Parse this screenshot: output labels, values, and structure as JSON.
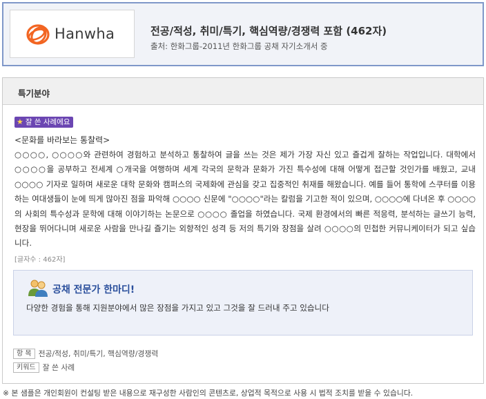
{
  "header": {
    "logo_text": "Hanwha",
    "title": "전공/적성, 취미/특기, 핵심역량/경쟁력 포함 (462자)",
    "source": "출처: 한화그룹-2011년 한화그룹 공채 자기소개서 중"
  },
  "panel": {
    "heading": "특기분야",
    "badge": "잘 쓴 사례에요",
    "essay_title": "<문화를 바라보는 통찰력>",
    "essay_body": "○○○○, ○○○○와 관련하여 경험하고 분석하고 통찰하여 글을 쓰는 것은 제가 가장 자신 있고 즐겁게 잘하는 작업입니다. 대학에서 ○○○○을 공부하고 전세계 ○개국을 여행하며 세계 각국의 문학과 문화가 가진 특수성에 대해 어떻게 접근할 것인가를 배웠고, 교내 ○○○○ 기자로 일하며 새로운 대학 문화와 캠퍼스의 국제화에 관심을 갖고 집중적인 취재를 해왔습니다. 예를 들어 통학에 스쿠터를 이용하는 여대생들이 눈에 띄게 많아진 점을 파악해 ○○○○ 신문에 \"○○○○\"라는 칼럼을 기고한 적이 있으며, ○○○○에 다녀온 후 ○○○○의 사회의 특수성과 문학에 대해 이야기하는 논문으로 ○○○○ 졸업을 하였습니다. 국제 환경에서의 빠른 적응력, 분석하는 글쓰기 능력, 현장을 뛰어다니며 새로운 사람을 만나길 즐기는 외향적인 성격 등 저의 특기와 장점을 살려 ○○○○의 민첩한 커뮤니케이터가 되고 싶습니다.",
    "char_count": "[글자수 : 462자]"
  },
  "expert": {
    "title": "공채 전문가 한마디!",
    "comment": "다양한 경험을 통해 지원분야에서 많은 장점을 가지고 있고 그것을 잘 드러내 주고 있습니다"
  },
  "tags": {
    "item_label": "항 목",
    "item_value": "전공/적성, 취미/특기, 핵심역량/경쟁력",
    "keyword_label": "키워드",
    "keyword_value": "잘 쓴 사례"
  },
  "footer": {
    "note": "※ 본 샘플은 개인회원이 컨설팅 받은 내용으로 재구성한 사람인의 콘텐츠로, 상업적 목적으로 사용 시 법적 조치를 받을 수 있습니다."
  },
  "colors": {
    "header_border": "#7f97c9",
    "logo_orange": "#f26522",
    "badge_purple": "#6b46b2",
    "expert_title_blue": "#2a4f9c"
  },
  "icons": {
    "logo": "hanwha-triple-ring-icon",
    "badge": "star-icon",
    "expert": "consultants-icon"
  }
}
